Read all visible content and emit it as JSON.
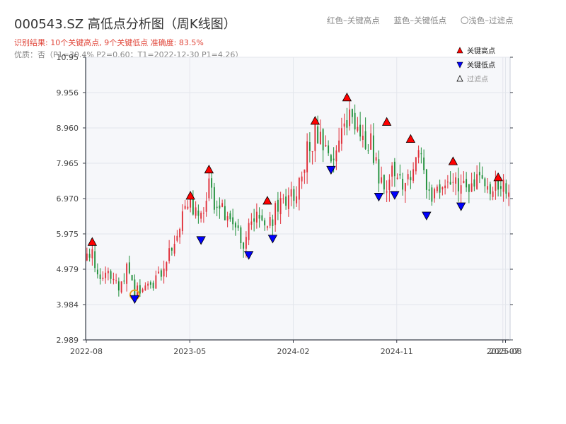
{
  "header": {
    "title": "000543.SZ 高低点分析图（周K线图）",
    "result_line": "识别结果: 10个关键高点, 9个关键低点  准确度: 83.5%",
    "quality_line": "优质：否（P1=30.4%  P2=0.60；T1=2022-12-30 P1=4.26）"
  },
  "top_legend": {
    "red": "红色–关键高点",
    "blue": "蓝色–关键低点",
    "light": "〇浅色–过滤点"
  },
  "colors": {
    "up": "#e0303a",
    "down": "#1f8f3a",
    "high_marker": "#ff0000",
    "low_marker": "#0000ff",
    "filtered_ring": "#f0a020",
    "plot_bg": "#f6f7fa",
    "grid": "#e3e6ec",
    "axis": "#3a3f4a"
  },
  "chart_data": {
    "type": "candlestick",
    "title": "000543.SZ 高低点分析图（周K线图）",
    "xlabel": "",
    "ylabel": "",
    "ylim": [
      2.989,
      10.95
    ],
    "y_ticks": [
      "10.95",
      "9.956",
      "8.960",
      "7.965",
      "6.970",
      "5.975",
      "4.979",
      "3.984",
      "2.989"
    ],
    "x_ticks": [
      {
        "label": "2022-08",
        "at": 0
      },
      {
        "label": "2023-05",
        "at": 39
      },
      {
        "label": "2024-02",
        "at": 78
      },
      {
        "label": "2024-11",
        "at": 117
      },
      {
        "label": "2025-07",
        "at": 157
      },
      {
        "label": "2025-08",
        "at": 158
      }
    ],
    "grid": true,
    "legend": {
      "placement": "top-right",
      "entries": [
        {
          "name": "关键高点",
          "marker": "up-triangle-red"
        },
        {
          "name": "关键低点",
          "marker": "down-triangle-blue"
        },
        {
          "name": "过滤点",
          "marker": "up-triangle-hollow"
        }
      ]
    },
    "price_path": [
      [
        0,
        5.25
      ],
      [
        2,
        5.5
      ],
      [
        5,
        4.6
      ],
      [
        9,
        4.8
      ],
      [
        12,
        4.55
      ],
      [
        15,
        4.95
      ],
      [
        18,
        4.3
      ],
      [
        21,
        4.45
      ],
      [
        25,
        4.55
      ],
      [
        28,
        4.95
      ],
      [
        31,
        5.4
      ],
      [
        34,
        5.95
      ],
      [
        37,
        6.6
      ],
      [
        39,
        6.85
      ],
      [
        42,
        6.3
      ],
      [
        44,
        6.6
      ],
      [
        46,
        7.45
      ],
      [
        48,
        6.9
      ],
      [
        52,
        6.55
      ],
      [
        56,
        6.2
      ],
      [
        59,
        5.75
      ],
      [
        62,
        6.3
      ],
      [
        65,
        6.55
      ],
      [
        68,
        6.05
      ],
      [
        72,
        6.8
      ],
      [
        76,
        6.95
      ],
      [
        80,
        7.4
      ],
      [
        83,
        8.3
      ],
      [
        86,
        8.8
      ],
      [
        89,
        8.4
      ],
      [
        92,
        8.2
      ],
      [
        95,
        8.65
      ],
      [
        98,
        9.3
      ],
      [
        101,
        8.95
      ],
      [
        104,
        8.65
      ],
      [
        107,
        8.55
      ],
      [
        110,
        7.6
      ],
      [
        113,
        7.2
      ],
      [
        116,
        7.9
      ],
      [
        119,
        7.4
      ],
      [
        122,
        7.6
      ],
      [
        124,
        8.25
      ],
      [
        127,
        7.75
      ],
      [
        130,
        7.0
      ],
      [
        133,
        7.15
      ],
      [
        136,
        7.2
      ],
      [
        139,
        7.5
      ],
      [
        142,
        7.25
      ],
      [
        145,
        7.5
      ],
      [
        148,
        7.35
      ],
      [
        151,
        7.3
      ],
      [
        154,
        7.25
      ],
      [
        157,
        7.35
      ],
      [
        159,
        7.0
      ]
    ],
    "key_highs": [
      {
        "i": 2,
        "price": 5.63
      },
      {
        "i": 39,
        "price": 6.93
      },
      {
        "i": 46,
        "price": 7.67
      },
      {
        "i": 68,
        "price": 6.79
      },
      {
        "i": 86,
        "price": 9.04
      },
      {
        "i": 98,
        "price": 9.7
      },
      {
        "i": 113,
        "price": 9.01
      },
      {
        "i": 122,
        "price": 8.53
      },
      {
        "i": 138,
        "price": 7.9
      },
      {
        "i": 155,
        "price": 7.45
      }
    ],
    "key_lows": [
      {
        "i": 18,
        "price": 4.26
      },
      {
        "i": 43,
        "price": 5.92
      },
      {
        "i": 61,
        "price": 5.5
      },
      {
        "i": 70,
        "price": 5.96
      },
      {
        "i": 92,
        "price": 7.9
      },
      {
        "i": 110,
        "price": 7.14
      },
      {
        "i": 116,
        "price": 7.19
      },
      {
        "i": 128,
        "price": 6.61
      },
      {
        "i": 141,
        "price": 6.87
      }
    ],
    "filtered_points": [
      {
        "i": 18,
        "price": 4.26
      }
    ]
  }
}
